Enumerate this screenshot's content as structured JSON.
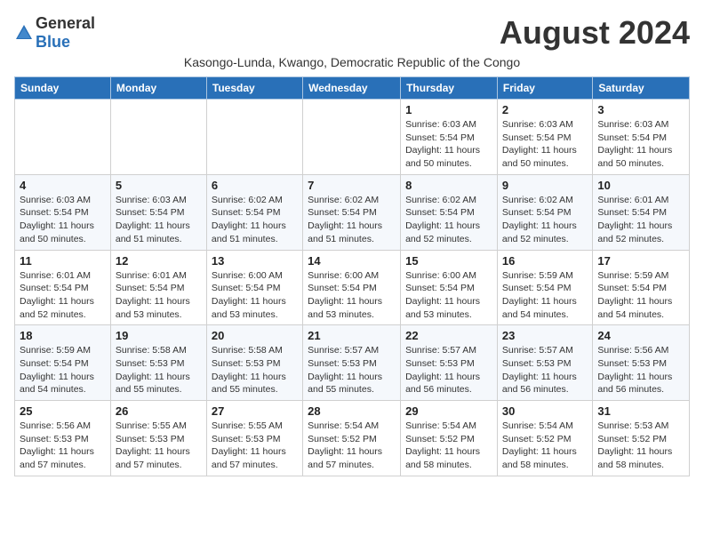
{
  "logo": {
    "general": "General",
    "blue": "Blue"
  },
  "title": "August 2024",
  "subtitle": "Kasongo-Lunda, Kwango, Democratic Republic of the Congo",
  "headers": [
    "Sunday",
    "Monday",
    "Tuesday",
    "Wednesday",
    "Thursday",
    "Friday",
    "Saturday"
  ],
  "weeks": [
    [
      {
        "day": "",
        "info": ""
      },
      {
        "day": "",
        "info": ""
      },
      {
        "day": "",
        "info": ""
      },
      {
        "day": "",
        "info": ""
      },
      {
        "day": "1",
        "info": "Sunrise: 6:03 AM\nSunset: 5:54 PM\nDaylight: 11 hours and 50 minutes."
      },
      {
        "day": "2",
        "info": "Sunrise: 6:03 AM\nSunset: 5:54 PM\nDaylight: 11 hours and 50 minutes."
      },
      {
        "day": "3",
        "info": "Sunrise: 6:03 AM\nSunset: 5:54 PM\nDaylight: 11 hours and 50 minutes."
      }
    ],
    [
      {
        "day": "4",
        "info": "Sunrise: 6:03 AM\nSunset: 5:54 PM\nDaylight: 11 hours and 50 minutes."
      },
      {
        "day": "5",
        "info": "Sunrise: 6:03 AM\nSunset: 5:54 PM\nDaylight: 11 hours and 51 minutes."
      },
      {
        "day": "6",
        "info": "Sunrise: 6:02 AM\nSunset: 5:54 PM\nDaylight: 11 hours and 51 minutes."
      },
      {
        "day": "7",
        "info": "Sunrise: 6:02 AM\nSunset: 5:54 PM\nDaylight: 11 hours and 51 minutes."
      },
      {
        "day": "8",
        "info": "Sunrise: 6:02 AM\nSunset: 5:54 PM\nDaylight: 11 hours and 52 minutes."
      },
      {
        "day": "9",
        "info": "Sunrise: 6:02 AM\nSunset: 5:54 PM\nDaylight: 11 hours and 52 minutes."
      },
      {
        "day": "10",
        "info": "Sunrise: 6:01 AM\nSunset: 5:54 PM\nDaylight: 11 hours and 52 minutes."
      }
    ],
    [
      {
        "day": "11",
        "info": "Sunrise: 6:01 AM\nSunset: 5:54 PM\nDaylight: 11 hours and 52 minutes."
      },
      {
        "day": "12",
        "info": "Sunrise: 6:01 AM\nSunset: 5:54 PM\nDaylight: 11 hours and 53 minutes."
      },
      {
        "day": "13",
        "info": "Sunrise: 6:00 AM\nSunset: 5:54 PM\nDaylight: 11 hours and 53 minutes."
      },
      {
        "day": "14",
        "info": "Sunrise: 6:00 AM\nSunset: 5:54 PM\nDaylight: 11 hours and 53 minutes."
      },
      {
        "day": "15",
        "info": "Sunrise: 6:00 AM\nSunset: 5:54 PM\nDaylight: 11 hours and 53 minutes."
      },
      {
        "day": "16",
        "info": "Sunrise: 5:59 AM\nSunset: 5:54 PM\nDaylight: 11 hours and 54 minutes."
      },
      {
        "day": "17",
        "info": "Sunrise: 5:59 AM\nSunset: 5:54 PM\nDaylight: 11 hours and 54 minutes."
      }
    ],
    [
      {
        "day": "18",
        "info": "Sunrise: 5:59 AM\nSunset: 5:54 PM\nDaylight: 11 hours and 54 minutes."
      },
      {
        "day": "19",
        "info": "Sunrise: 5:58 AM\nSunset: 5:53 PM\nDaylight: 11 hours and 55 minutes."
      },
      {
        "day": "20",
        "info": "Sunrise: 5:58 AM\nSunset: 5:53 PM\nDaylight: 11 hours and 55 minutes."
      },
      {
        "day": "21",
        "info": "Sunrise: 5:57 AM\nSunset: 5:53 PM\nDaylight: 11 hours and 55 minutes."
      },
      {
        "day": "22",
        "info": "Sunrise: 5:57 AM\nSunset: 5:53 PM\nDaylight: 11 hours and 56 minutes."
      },
      {
        "day": "23",
        "info": "Sunrise: 5:57 AM\nSunset: 5:53 PM\nDaylight: 11 hours and 56 minutes."
      },
      {
        "day": "24",
        "info": "Sunrise: 5:56 AM\nSunset: 5:53 PM\nDaylight: 11 hours and 56 minutes."
      }
    ],
    [
      {
        "day": "25",
        "info": "Sunrise: 5:56 AM\nSunset: 5:53 PM\nDaylight: 11 hours and 57 minutes."
      },
      {
        "day": "26",
        "info": "Sunrise: 5:55 AM\nSunset: 5:53 PM\nDaylight: 11 hours and 57 minutes."
      },
      {
        "day": "27",
        "info": "Sunrise: 5:55 AM\nSunset: 5:53 PM\nDaylight: 11 hours and 57 minutes."
      },
      {
        "day": "28",
        "info": "Sunrise: 5:54 AM\nSunset: 5:52 PM\nDaylight: 11 hours and 57 minutes."
      },
      {
        "day": "29",
        "info": "Sunrise: 5:54 AM\nSunset: 5:52 PM\nDaylight: 11 hours and 58 minutes."
      },
      {
        "day": "30",
        "info": "Sunrise: 5:54 AM\nSunset: 5:52 PM\nDaylight: 11 hours and 58 minutes."
      },
      {
        "day": "31",
        "info": "Sunrise: 5:53 AM\nSunset: 5:52 PM\nDaylight: 11 hours and 58 minutes."
      }
    ]
  ]
}
